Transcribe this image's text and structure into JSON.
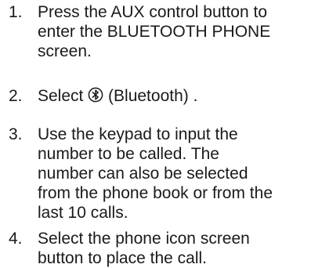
{
  "steps": [
    {
      "number": "1.",
      "lines": [
        "Press the AUX control button to",
        "enter the BLUETOOTH PHONE",
        "screen."
      ]
    },
    {
      "number": "2.",
      "before_icon": "Select ",
      "icon": "bluetooth-icon",
      "after_icon": " (Bluetooth) ."
    },
    {
      "number": "3.",
      "lines": [
        "Use the keypad to input the",
        "number to be called. The",
        "number can also be selected",
        "from the phone book or from the",
        "last 10 calls."
      ]
    },
    {
      "number": "4.",
      "lines": [
        "Select the phone icon screen",
        "button to place the call."
      ]
    }
  ]
}
